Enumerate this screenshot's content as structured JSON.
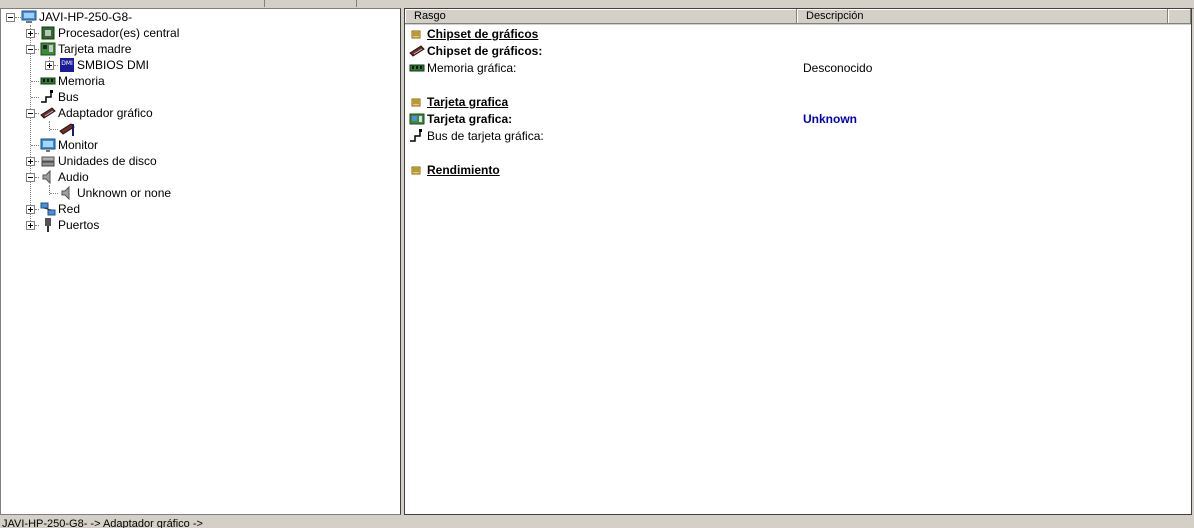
{
  "tree": {
    "root_label": "JAVI-HP-250-G8-",
    "items": [
      {
        "label": "Procesador(es) central"
      },
      {
        "label": "Tarjeta madre"
      },
      {
        "label": "SMBIOS DMI"
      },
      {
        "label": "Memoria"
      },
      {
        "label": "Bus"
      },
      {
        "label": "Adaptador gráfico"
      },
      {
        "label": "Monitor"
      },
      {
        "label": "Unidades de disco"
      },
      {
        "label": "Audio"
      },
      {
        "label": "Unknown or none"
      },
      {
        "label": "Red"
      },
      {
        "label": "Puertos"
      }
    ]
  },
  "table": {
    "col_rasgo": "Rasgo",
    "col_descripcion": "Descripción",
    "rows": [
      {
        "label": "Chipset de gráficos",
        "value": ""
      },
      {
        "label": "Chipset de gráficos:",
        "value": ""
      },
      {
        "label": "Memoria gráfica:",
        "value": "Desconocido"
      },
      {
        "label": "Tarjeta grafica",
        "value": ""
      },
      {
        "label": "Tarjeta grafica:",
        "value": "Unknown"
      },
      {
        "label": "Bus de tarjeta gráfica:",
        "value": ""
      },
      {
        "label": "Rendimiento",
        "value": ""
      }
    ]
  },
  "status": {
    "path": "JAVI-HP-250-G8- -> Adaptador gráfico ->"
  }
}
